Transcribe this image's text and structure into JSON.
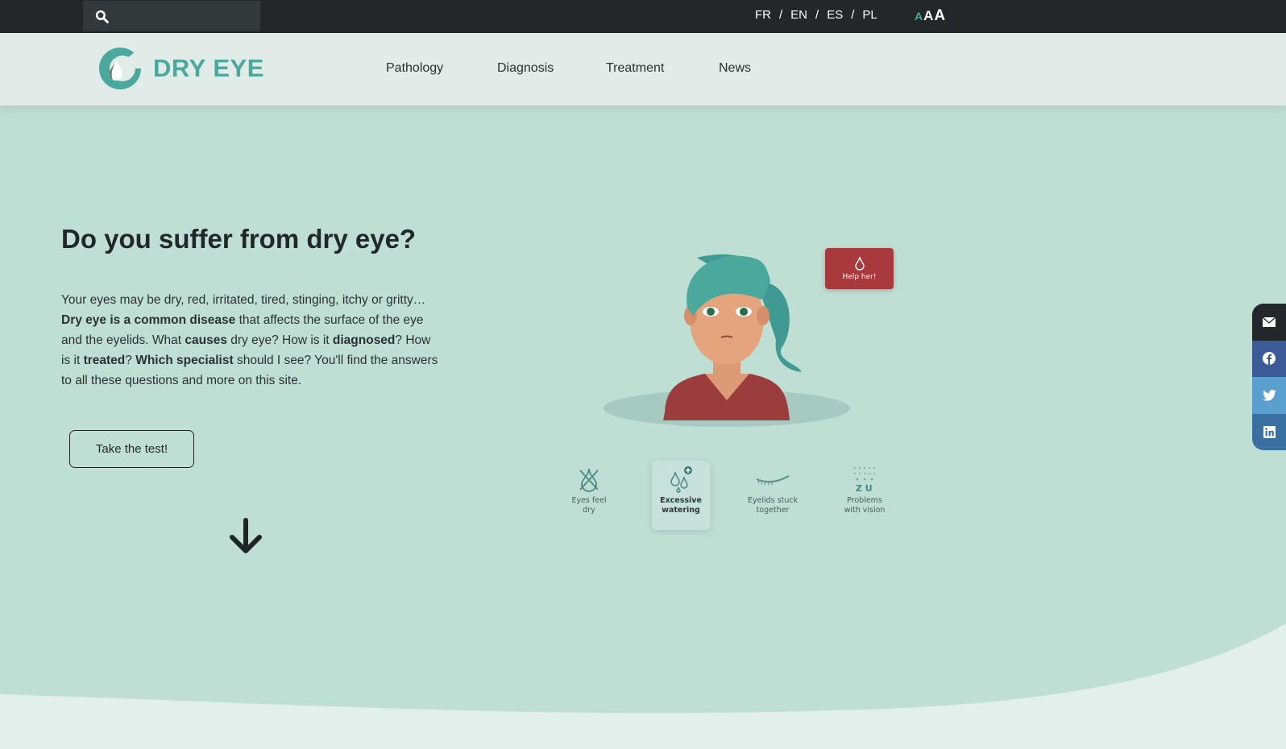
{
  "topbar": {
    "search_placeholder": "",
    "languages": [
      "FR",
      "EN",
      "ES",
      "PL"
    ],
    "separator": "/",
    "text_size": [
      "A",
      "A",
      "A"
    ]
  },
  "header": {
    "logo_text": "DRY EYE",
    "nav": [
      "Pathology",
      "Diagnosis",
      "Treatment",
      "News"
    ]
  },
  "hero": {
    "title": "Do you suffer from dry eye?",
    "intro": [
      {
        "t": "Your eyes may be dry, red, irritated, tired, stinging, itchy or gritty… ",
        "b": false
      },
      {
        "t": "Dry eye is a common disease",
        "b": true
      },
      {
        "t": " that affects the surface of the eye and the eyelids. What ",
        "b": false
      },
      {
        "t": "causes",
        "b": true
      },
      {
        "t": " dry eye? How is it ",
        "b": false
      },
      {
        "t": "diagnosed",
        "b": true
      },
      {
        "t": "? How is it ",
        "b": false
      },
      {
        "t": "treated",
        "b": true
      },
      {
        "t": "? ",
        "b": false
      },
      {
        "t": "Which specialist",
        "b": true
      },
      {
        "t": " should I see? You'll find the answers to all these questions and more on this site.",
        "b": false
      }
    ],
    "test_button": "Take the test!"
  },
  "illustration": {
    "help_button": "Help her!",
    "symptoms": [
      {
        "label1": "Eyes feel",
        "label2": "dry",
        "icon": "crossed-drop-icon",
        "active": false
      },
      {
        "label1": "Excessive",
        "label2": "watering",
        "icon": "drops-plus-icon",
        "active": true
      },
      {
        "label1": "Eyelids stuck",
        "label2": "together",
        "icon": "closed-eyelid-icon",
        "active": false
      },
      {
        "label1": "Problems",
        "label2": "with vision",
        "icon": "eye-chart-icon",
        "active": false
      }
    ]
  },
  "social": [
    "email-icon",
    "facebook-icon",
    "twitter-icon",
    "linkedin-icon"
  ],
  "colors": {
    "accent": "#4aa89c",
    "background": "#bfded4",
    "topbar": "#23272a",
    "help": "#a8393d",
    "email": "#23272a",
    "facebook": "#3d5a98",
    "twitter": "#5aa0cf",
    "linkedin": "#3a6fa2"
  }
}
